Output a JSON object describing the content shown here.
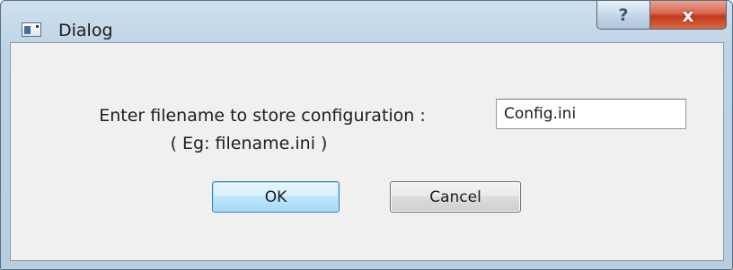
{
  "window": {
    "title": "Dialog",
    "help_glyph": "?",
    "close_glyph": "x"
  },
  "form": {
    "prompt": "Enter filename to store configuration :",
    "example": "( Eg: filename.ini )",
    "filename_value": "Config.ini"
  },
  "buttons": {
    "ok_label": "OK",
    "cancel_label": "Cancel"
  },
  "colors": {
    "accent_blue": "#3c7fb1",
    "close_red": "#c2391b"
  },
  "icons": {
    "app": "dialog-window-icon",
    "help": "help-question-icon",
    "close": "close-x-icon"
  }
}
